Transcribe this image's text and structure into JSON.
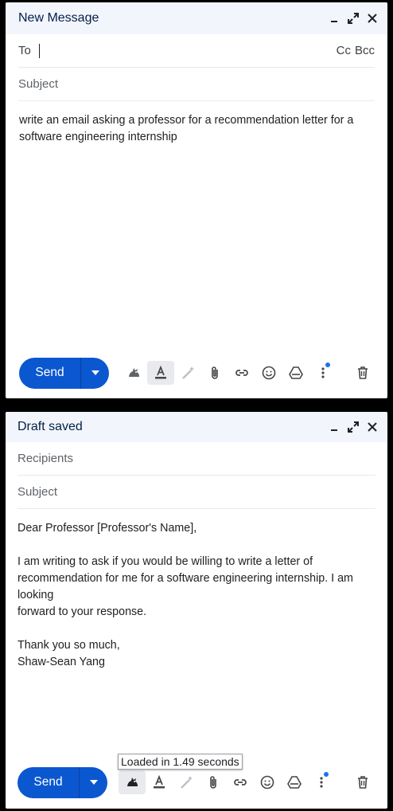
{
  "window1": {
    "title": "New Message",
    "to_label": "To",
    "cc_label": "Cc",
    "bcc_label": "Bcc",
    "subject_placeholder": "Subject",
    "body_lines": [
      "write an email asking a professor for a recommendation letter for a",
      "software engineering internship"
    ],
    "send_label": "Send"
  },
  "window2": {
    "title": "Draft saved",
    "recipients_placeholder": "Recipients",
    "subject_placeholder": "Subject",
    "greeting": "Dear Professor [Professor's Name],",
    "paragraph_lines": [
      "I am writing to ask if you would be willing to write a letter of",
      "recommendation for me for a software engineering internship. I am",
      "looking",
      "forward to your response."
    ],
    "closing": "Thank you so much,",
    "signature": "Shaw-Sean Yang",
    "send_label": "Send"
  },
  "tooltip": "Loaded in 1.49 seconds",
  "colors": {
    "send_blue": "#0b57d0",
    "titlebar_bg": "#f2f6fc",
    "title_text": "#041e49",
    "notify_dot": "#1a73e8"
  },
  "icons": [
    "minimize-icon",
    "expand-icon",
    "close-icon",
    "dropdown-arrow-icon",
    "ai-assistant-icon",
    "text-format-icon",
    "magic-pen-icon",
    "attach-icon",
    "link-icon",
    "emoji-icon",
    "drive-icon",
    "more-options-icon",
    "trash-icon"
  ]
}
